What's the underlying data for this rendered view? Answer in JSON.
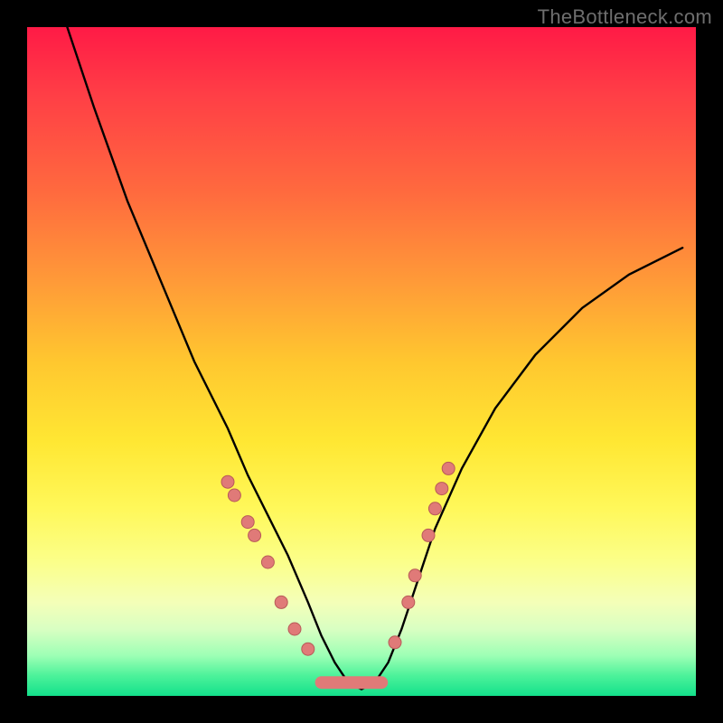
{
  "watermark": "TheBottleneck.com",
  "chart_data": {
    "type": "line",
    "title": "",
    "xlabel": "",
    "ylabel": "",
    "xlim": [
      0,
      100
    ],
    "ylim": [
      0,
      100
    ],
    "series": [
      {
        "name": "curve",
        "x": [
          6,
          10,
          15,
          20,
          25,
          30,
          33,
          36,
          39,
          42,
          44,
          46,
          48,
          50,
          52,
          54,
          56,
          58,
          61,
          65,
          70,
          76,
          83,
          90,
          98
        ],
        "y": [
          100,
          88,
          74,
          62,
          50,
          40,
          33,
          27,
          21,
          14,
          9,
          5,
          2,
          1,
          2,
          5,
          10,
          16,
          25,
          34,
          43,
          51,
          58,
          63,
          67
        ]
      }
    ],
    "markers": {
      "left_cluster_x": [
        30,
        31,
        33,
        34,
        36,
        38,
        40,
        42
      ],
      "left_cluster_y": [
        32,
        30,
        26,
        24,
        20,
        14,
        10,
        7
      ],
      "right_cluster_x": [
        55,
        57,
        58,
        60,
        61,
        62,
        63
      ],
      "right_cluster_y": [
        8,
        14,
        18,
        24,
        28,
        31,
        34
      ],
      "flat_segment": {
        "x0": 44,
        "x1": 53,
        "y": 2
      }
    },
    "background_gradient": {
      "top": "#ff1a46",
      "mid": "#ffe733",
      "bottom": "#13e08b"
    }
  }
}
